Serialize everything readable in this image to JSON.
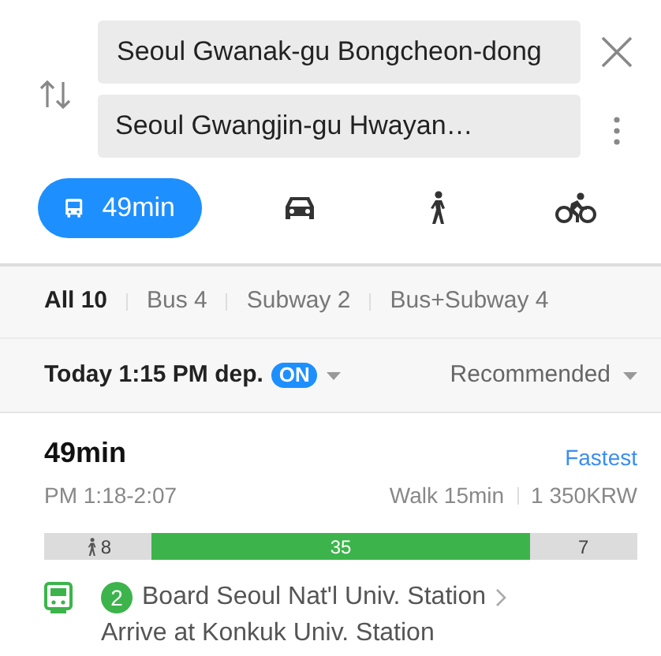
{
  "search": {
    "origin": "Seoul Gwanak-gu Bongcheon-dong",
    "destination": "Seoul Gwangjin-gu Hwayan…"
  },
  "modes": [
    {
      "kind": "transit",
      "label": "49min",
      "selected": true
    },
    {
      "kind": "car",
      "selected": false
    },
    {
      "kind": "walk",
      "selected": false
    },
    {
      "kind": "bike",
      "selected": false
    }
  ],
  "filters": [
    {
      "label": "All 10",
      "selected": true
    },
    {
      "label": "Bus 4",
      "selected": false
    },
    {
      "label": "Subway 2",
      "selected": false
    },
    {
      "label": "Bus+Subway 4",
      "selected": false
    }
  ],
  "departure": {
    "label": "Today 1:15 PM dep.",
    "badge": "ON",
    "on": true
  },
  "sort": "Recommended",
  "route": {
    "duration": "49min",
    "tag": "Fastest",
    "times": "PM 1:18-2:07",
    "walk": "Walk 15min",
    "fare": "1 350KRW",
    "segments": [
      {
        "kind": "walk",
        "label": "8"
      },
      {
        "kind": "subway",
        "label": "35",
        "color": "#3cb44b"
      },
      {
        "kind": "other",
        "label": "7"
      }
    ],
    "steps": [
      {
        "line": "2",
        "color": "#3cb44b",
        "board": "Board Seoul Nat'l Univ. Station",
        "arrive": "Arrive at Konkuk Univ. Station"
      }
    ]
  }
}
